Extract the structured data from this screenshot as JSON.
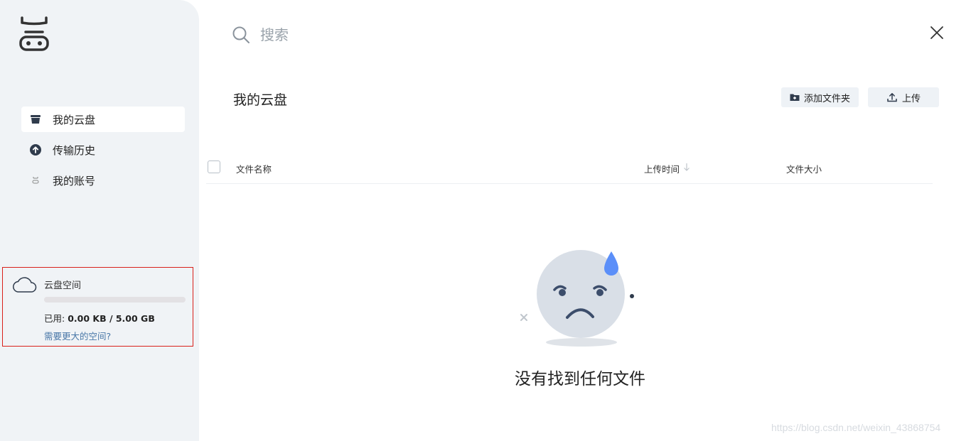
{
  "search": {
    "placeholder": "搜索"
  },
  "sidebar": {
    "items": [
      {
        "label": "我的云盘",
        "icon": "drive-icon",
        "active": true
      },
      {
        "label": "传输历史",
        "icon": "upload-circle-icon",
        "active": false
      },
      {
        "label": "我的账号",
        "icon": "user-icon",
        "active": false
      }
    ],
    "storage": {
      "title": "云盘空间",
      "used_prefix": "已用: ",
      "used_value": "0.00 KB / 5.00 GB",
      "used_fraction": 0,
      "more_link": "需要更大的空间?"
    }
  },
  "main": {
    "title": "我的云盘",
    "add_folder_label": "添加文件夹",
    "upload_label": "上传",
    "columns": {
      "name": "文件名称",
      "time": "上传时间",
      "size": "文件大小"
    },
    "empty_text": "没有找到任何文件"
  },
  "watermark": "https://blog.csdn.net/weixin_43868754",
  "colors": {
    "sidebar_bg": "#f0f3f6",
    "accent": "#4a78a8",
    "highlight_border": "#d9201a",
    "drop": "#5b8ff9"
  }
}
